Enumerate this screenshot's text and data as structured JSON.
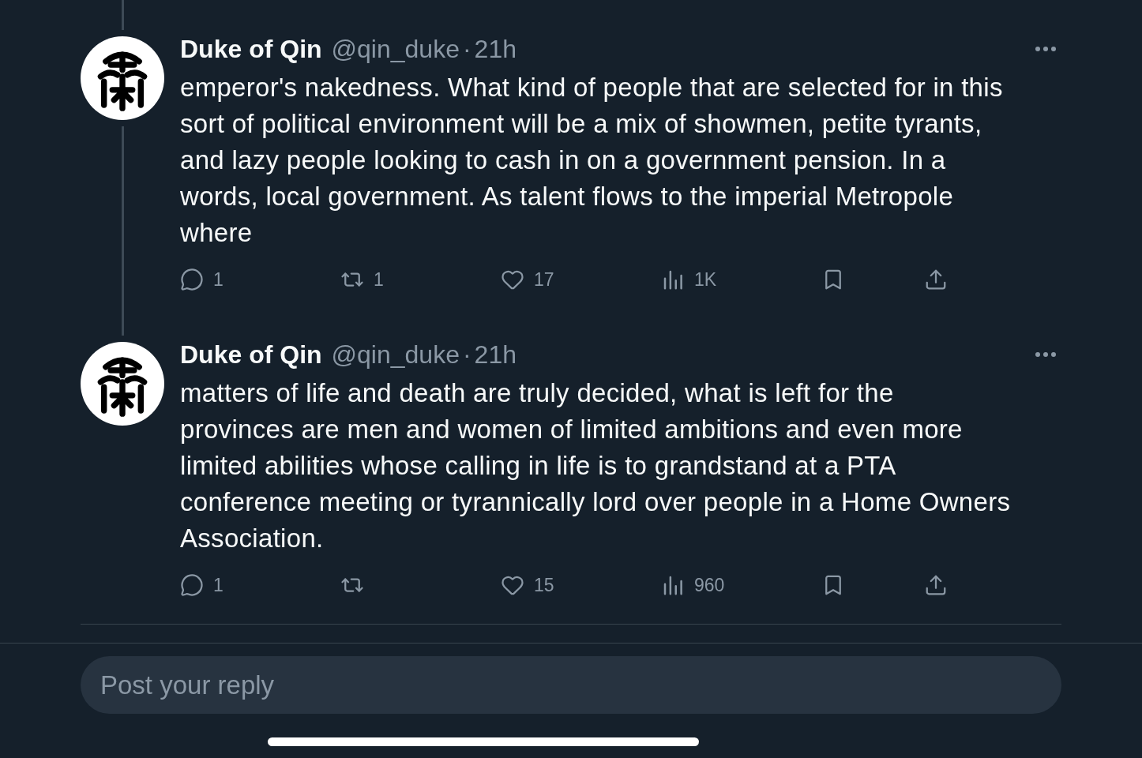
{
  "thread": {
    "tweets": [
      {
        "author": {
          "name": "Duke of Qin",
          "handle": "@qin_duke"
        },
        "separator": "·",
        "time": "21h",
        "thread_line_above": true,
        "thread_line_below": true,
        "text": "emperor's nakedness. What kind of people that are selected for in this sort of political environment will be a mix of showmen, petite tyrants, and lazy people looking to cash in on a government pension. In a words, local government. As talent flows to the imperial Metropole where",
        "actions": [
          {
            "kind": "reply",
            "count": "1"
          },
          {
            "kind": "repost",
            "count": "1"
          },
          {
            "kind": "like",
            "count": "17"
          },
          {
            "kind": "views",
            "count": "1K"
          },
          {
            "kind": "bookmark"
          },
          {
            "kind": "share"
          }
        ]
      },
      {
        "author": {
          "name": "Duke of Qin",
          "handle": "@qin_duke"
        },
        "separator": "·",
        "time": "21h",
        "thread_line_above": true,
        "thread_line_below": false,
        "text": "matters of life and death are truly decided, what is left for the provinces are men and women of limited ambitions and even more limited abilities whose calling in life is to grandstand at a PTA conference meeting or tyrannically lord over people in a Home Owners Association.",
        "actions": [
          {
            "kind": "reply",
            "count": "1"
          },
          {
            "kind": "repost"
          },
          {
            "kind": "like",
            "count": "15"
          },
          {
            "kind": "views",
            "count": "960"
          },
          {
            "kind": "bookmark"
          },
          {
            "kind": "share"
          }
        ]
      }
    ]
  },
  "reply_box": {
    "placeholder": "Post your reply"
  }
}
